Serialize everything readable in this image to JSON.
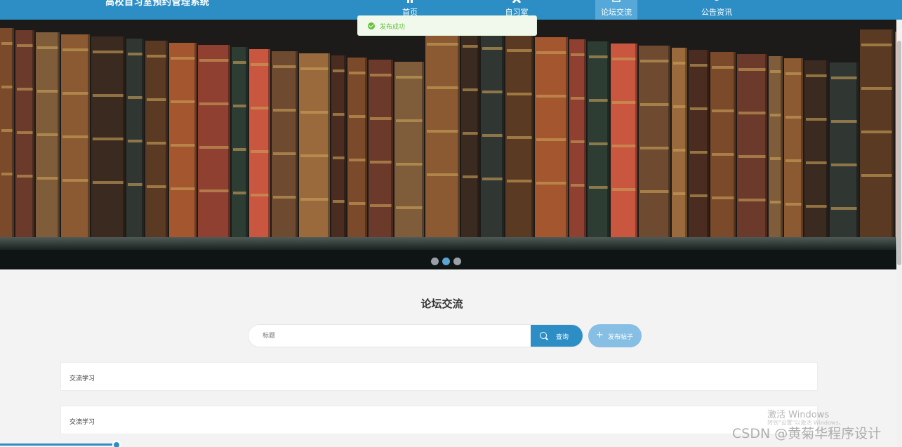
{
  "header": {
    "brand": "高校自习室预约管理系统",
    "nav": [
      {
        "label": "首页",
        "icon": "home-icon"
      },
      {
        "label": "自习室",
        "icon": "cross-icon"
      },
      {
        "label": "论坛交流",
        "icon": "forum-icon",
        "active": true
      },
      {
        "label": "公告资讯",
        "icon": "bulb-icon"
      }
    ]
  },
  "toast": {
    "message": "发布成功",
    "icon": "success-check-icon"
  },
  "carousel": {
    "slides": 3,
    "active_index": 1
  },
  "forum": {
    "title": "论坛交流",
    "search_placeholder": "标题",
    "search_button": "查询",
    "post_button": "发布帖子",
    "posts": [
      {
        "title": "交流学习"
      },
      {
        "title": "交流学习"
      }
    ]
  },
  "overlay": {
    "activate_title": "激活 Windows",
    "activate_sub": "转到\"设置\"以激活 Windows。",
    "csdn": "CSDN @黄菊华程序设计"
  },
  "colors": {
    "primary": "#2d8ec6",
    "success": "#67c23a"
  }
}
